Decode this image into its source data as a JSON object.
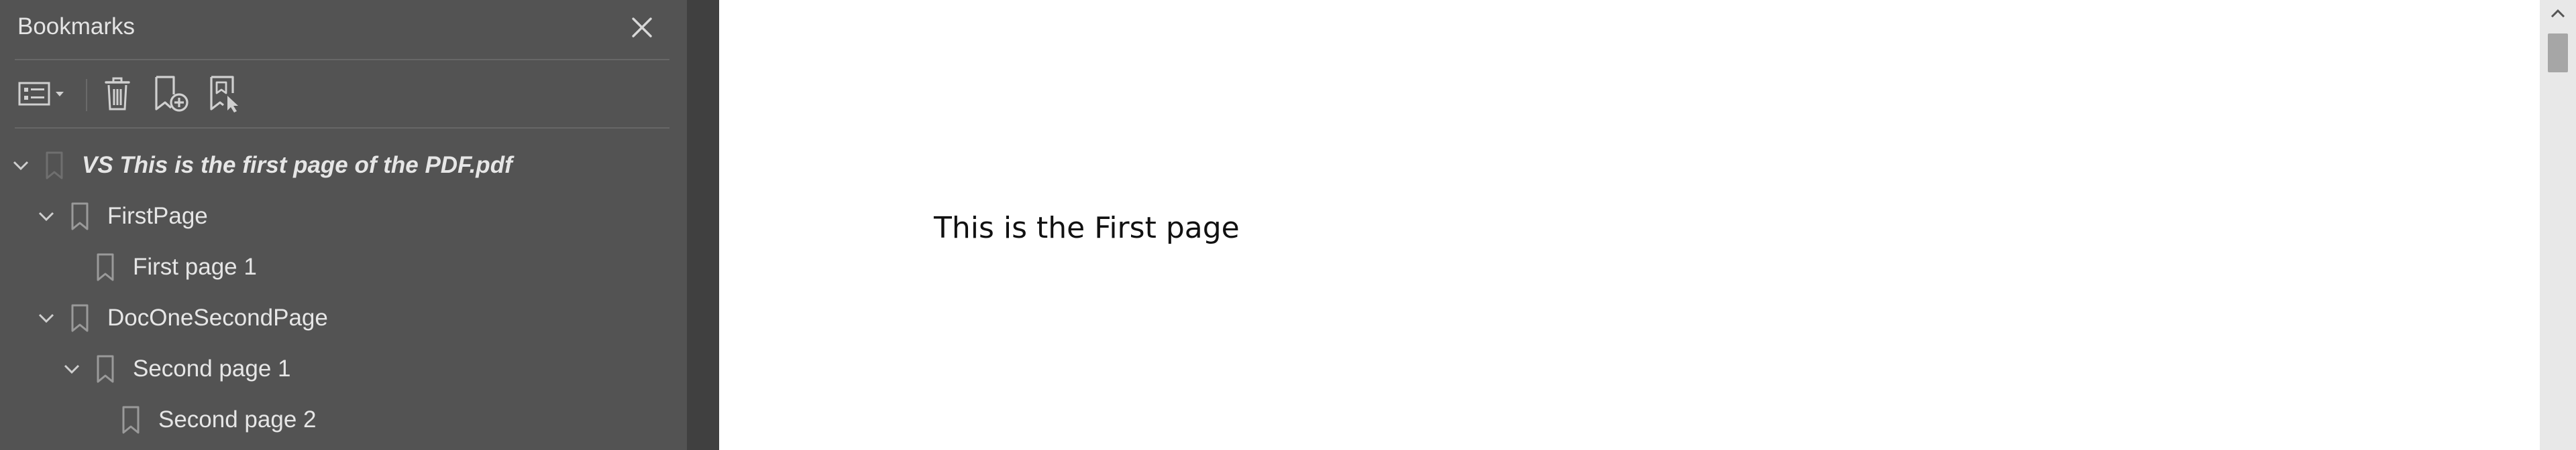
{
  "panel": {
    "title": "Bookmarks"
  },
  "toolbar": {
    "icons": [
      "options-menu-icon",
      "delete-bookmark-icon",
      "add-bookmark-icon",
      "new-bookmark-from-selection-icon"
    ]
  },
  "bookmarks": [
    {
      "label": "VS This is the first page of the PDF.pdf",
      "level": 0,
      "expanded": true,
      "root": true
    },
    {
      "label": "FirstPage",
      "level": 1,
      "expanded": true
    },
    {
      "label": "First page 1",
      "level": 2,
      "expanded": null
    },
    {
      "label": "DocOneSecondPage",
      "level": 1,
      "expanded": true
    },
    {
      "label": "Second page 1",
      "level": 2,
      "expanded": true
    },
    {
      "label": "Second page 2",
      "level": 3,
      "expanded": null
    }
  ],
  "document": {
    "text": "This is the First page"
  },
  "colors": {
    "panel_bg": "#535353",
    "gutter_bg": "#404040",
    "page_bg": "#ffffff",
    "icon": "#d0d0d0"
  }
}
